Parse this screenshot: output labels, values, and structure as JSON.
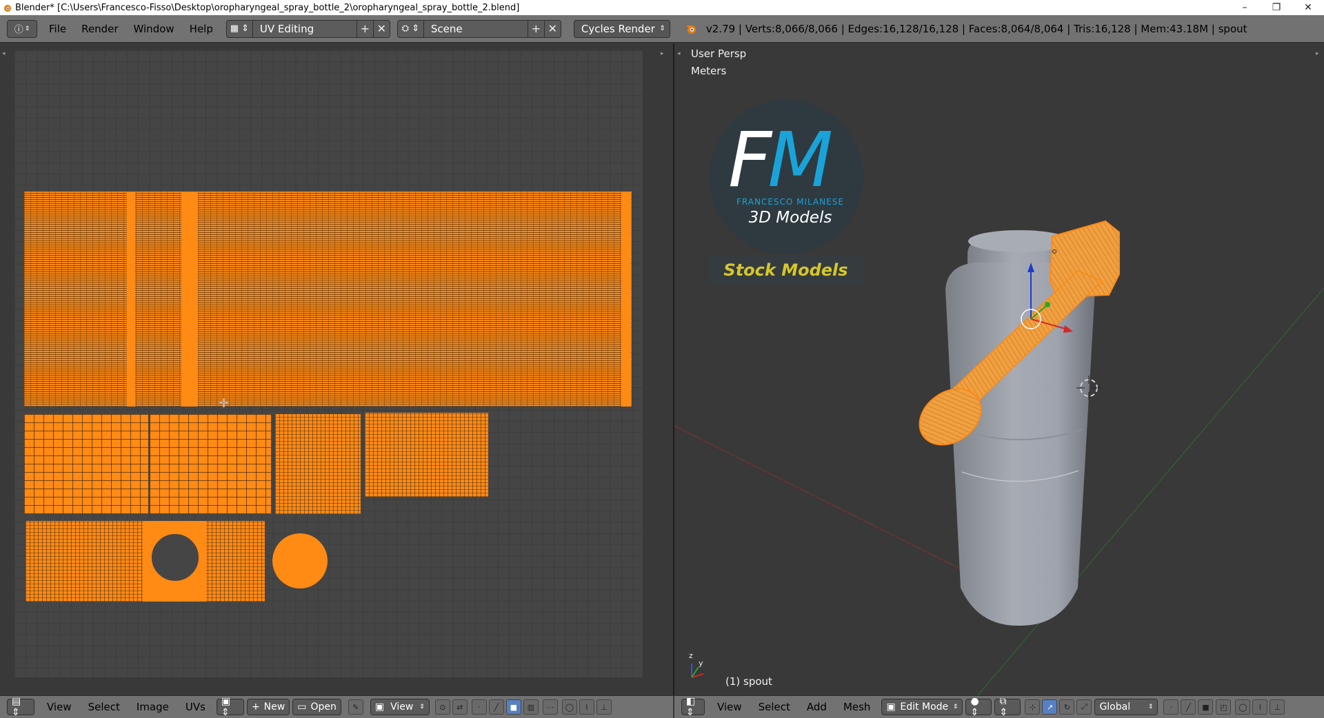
{
  "window": {
    "title": "Blender* [C:\\Users\\Francesco-Fisso\\Desktop\\oropharyngeal_spray_bottle_2\\oropharyngeal_spray_bottle_2.blend]",
    "minimize": "–",
    "maximize": "❐",
    "close": "✕"
  },
  "info_header": {
    "menus": [
      "File",
      "Render",
      "Window",
      "Help"
    ],
    "screen_layout": "UV Editing",
    "scene": "Scene",
    "render_engine": "Cycles Render",
    "stats": "v2.79 | Verts:8,066/8,066 | Edges:16,128/16,128 | Faces:8,064/8,064 | Tris:16,128 | Mem:43.18M | spout"
  },
  "uv_editor": {
    "menus": [
      "View",
      "Select",
      "Image",
      "UVs"
    ],
    "new_label": "New",
    "open_label": "Open",
    "view_label": "View"
  },
  "viewport": {
    "view_name": "User Persp",
    "units": "Meters",
    "object_label": "(1) spout",
    "menus": [
      "View",
      "Select",
      "Add",
      "Mesh"
    ],
    "mode": "Edit Mode",
    "orientation": "Global",
    "logo": {
      "letters_f": "F",
      "letters_m": "M",
      "brand": "FRANCESCO MILANESE",
      "tagline": "3D Models",
      "banner": "Stock Models"
    }
  },
  "colors": {
    "selection": "#ff8a14",
    "header": "#727272",
    "background": "#393939",
    "logo_blue": "#1aa3d9",
    "banner_yellow": "#d7c62a"
  }
}
